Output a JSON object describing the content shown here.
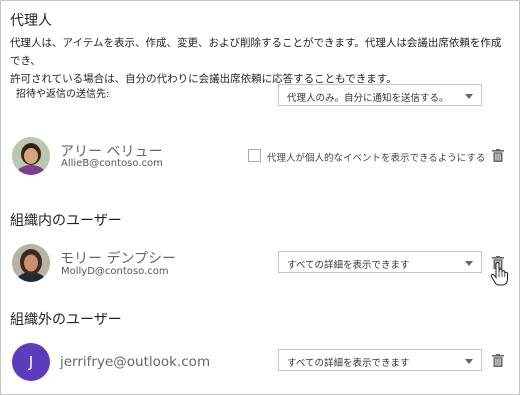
{
  "delegate": {
    "title": "代理人",
    "description_line1": "代理人は、アイテムを表示、作成、変更、および削除することができます。代理人は会議出席依頼を作成でき、",
    "description_line2": "許可されている場合は、自分の代わりに会議出席依頼に応答することもできます。",
    "send_to_label": "招待や返信の送信先:",
    "send_to_selected": "代理人のみ。自分に通知を送信する。",
    "person": {
      "name": "アリー ベリュー",
      "email": "AllieB@contoso.com",
      "checkbox_label": "代理人が個人的なイベントを表示できるようにする",
      "checkbox_checked": false
    }
  },
  "internal": {
    "title": "組織内のユーザー",
    "person": {
      "name": "モリー デンプシー",
      "email": "MollyD@contoso.com",
      "permission_selected": "すべての詳細を表示できます"
    }
  },
  "external": {
    "title": "組織外のユーザー",
    "person": {
      "avatar_initial": "J",
      "avatar_color": "#5c3bbd",
      "email": "jerrifrye@outlook.com",
      "permission_selected": "すべての詳細を表示できます"
    }
  }
}
